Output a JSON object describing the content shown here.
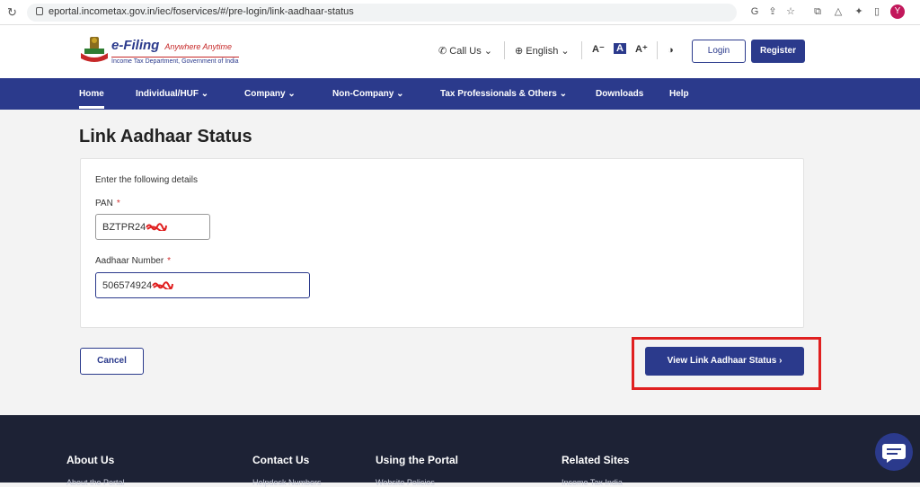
{
  "browser": {
    "url": "eportal.incometax.gov.in/iec/foservices/#/pre-login/link-aadhaar-status",
    "avatar_initial": "Y"
  },
  "header": {
    "logo_title": "e-Filing",
    "logo_tagline": "Anywhere Anytime",
    "logo_subtitle": "Income Tax Department, Government of India",
    "call_us": "Call Us",
    "language": "English",
    "font_decrease": "A⁻",
    "font_normal": "A",
    "font_increase": "A⁺",
    "login": "Login",
    "register": "Register"
  },
  "nav": {
    "items": [
      {
        "label": "Home"
      },
      {
        "label": "Individual/HUF"
      },
      {
        "label": "Company"
      },
      {
        "label": "Non-Company"
      },
      {
        "label": "Tax Professionals & Others"
      },
      {
        "label": "Downloads"
      },
      {
        "label": "Help"
      }
    ]
  },
  "main": {
    "title": "Link Aadhaar Status",
    "instructions": "Enter the following details",
    "pan_label": "PAN",
    "pan_value": "BZTPR24",
    "aadhaar_label": "Aadhaar Number",
    "aadhaar_value": "506574924",
    "required_mark": "*",
    "cancel": "Cancel",
    "view_status": "View Link Aadhaar Status"
  },
  "footer": {
    "columns": [
      {
        "heading": "About Us",
        "first_link": "About the Portal"
      },
      {
        "heading": "Contact Us",
        "first_link": "Helpdesk Numbers"
      },
      {
        "heading": "Using the Portal",
        "first_link": "Website Policies"
      },
      {
        "heading": "Related Sites",
        "first_link": "Income Tax India"
      }
    ]
  },
  "colors": {
    "brand": "#2b3a8c",
    "footer_bg": "#1d2235",
    "highlight": "#e02020"
  }
}
